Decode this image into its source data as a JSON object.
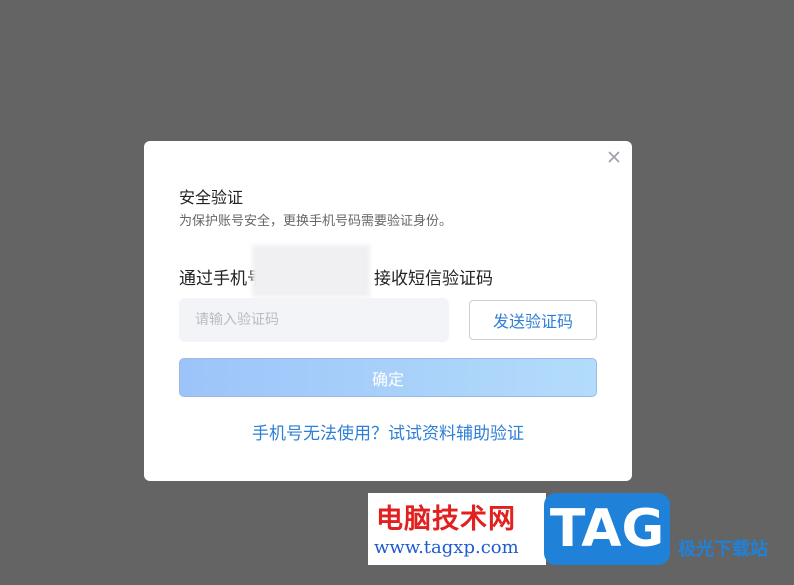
{
  "dialog": {
    "title": "安全验证",
    "subtitle": "为保护账号安全，更换手机号码需要验证身份。",
    "phone_prefix": "通过手机号",
    "phone_suffix": "接收短信验证码",
    "code_placeholder": "请输入验证码",
    "code_value": "",
    "send_code_label": "发送验证码",
    "confirm_label": "确定",
    "alt_link": "手机号无法使用？试试资料辅助验证",
    "close_icon": "close-icon"
  },
  "watermark": {
    "cn_text": "电脑技术网",
    "url": "www.tagxp.com",
    "tag": "TAG",
    "side_text": "极光下载站"
  },
  "colors": {
    "overlay": "#646464",
    "link": "#2f7fd6",
    "confirm_gradient_start": "#9cc4f9",
    "confirm_gradient_end": "#b3dcfb"
  }
}
